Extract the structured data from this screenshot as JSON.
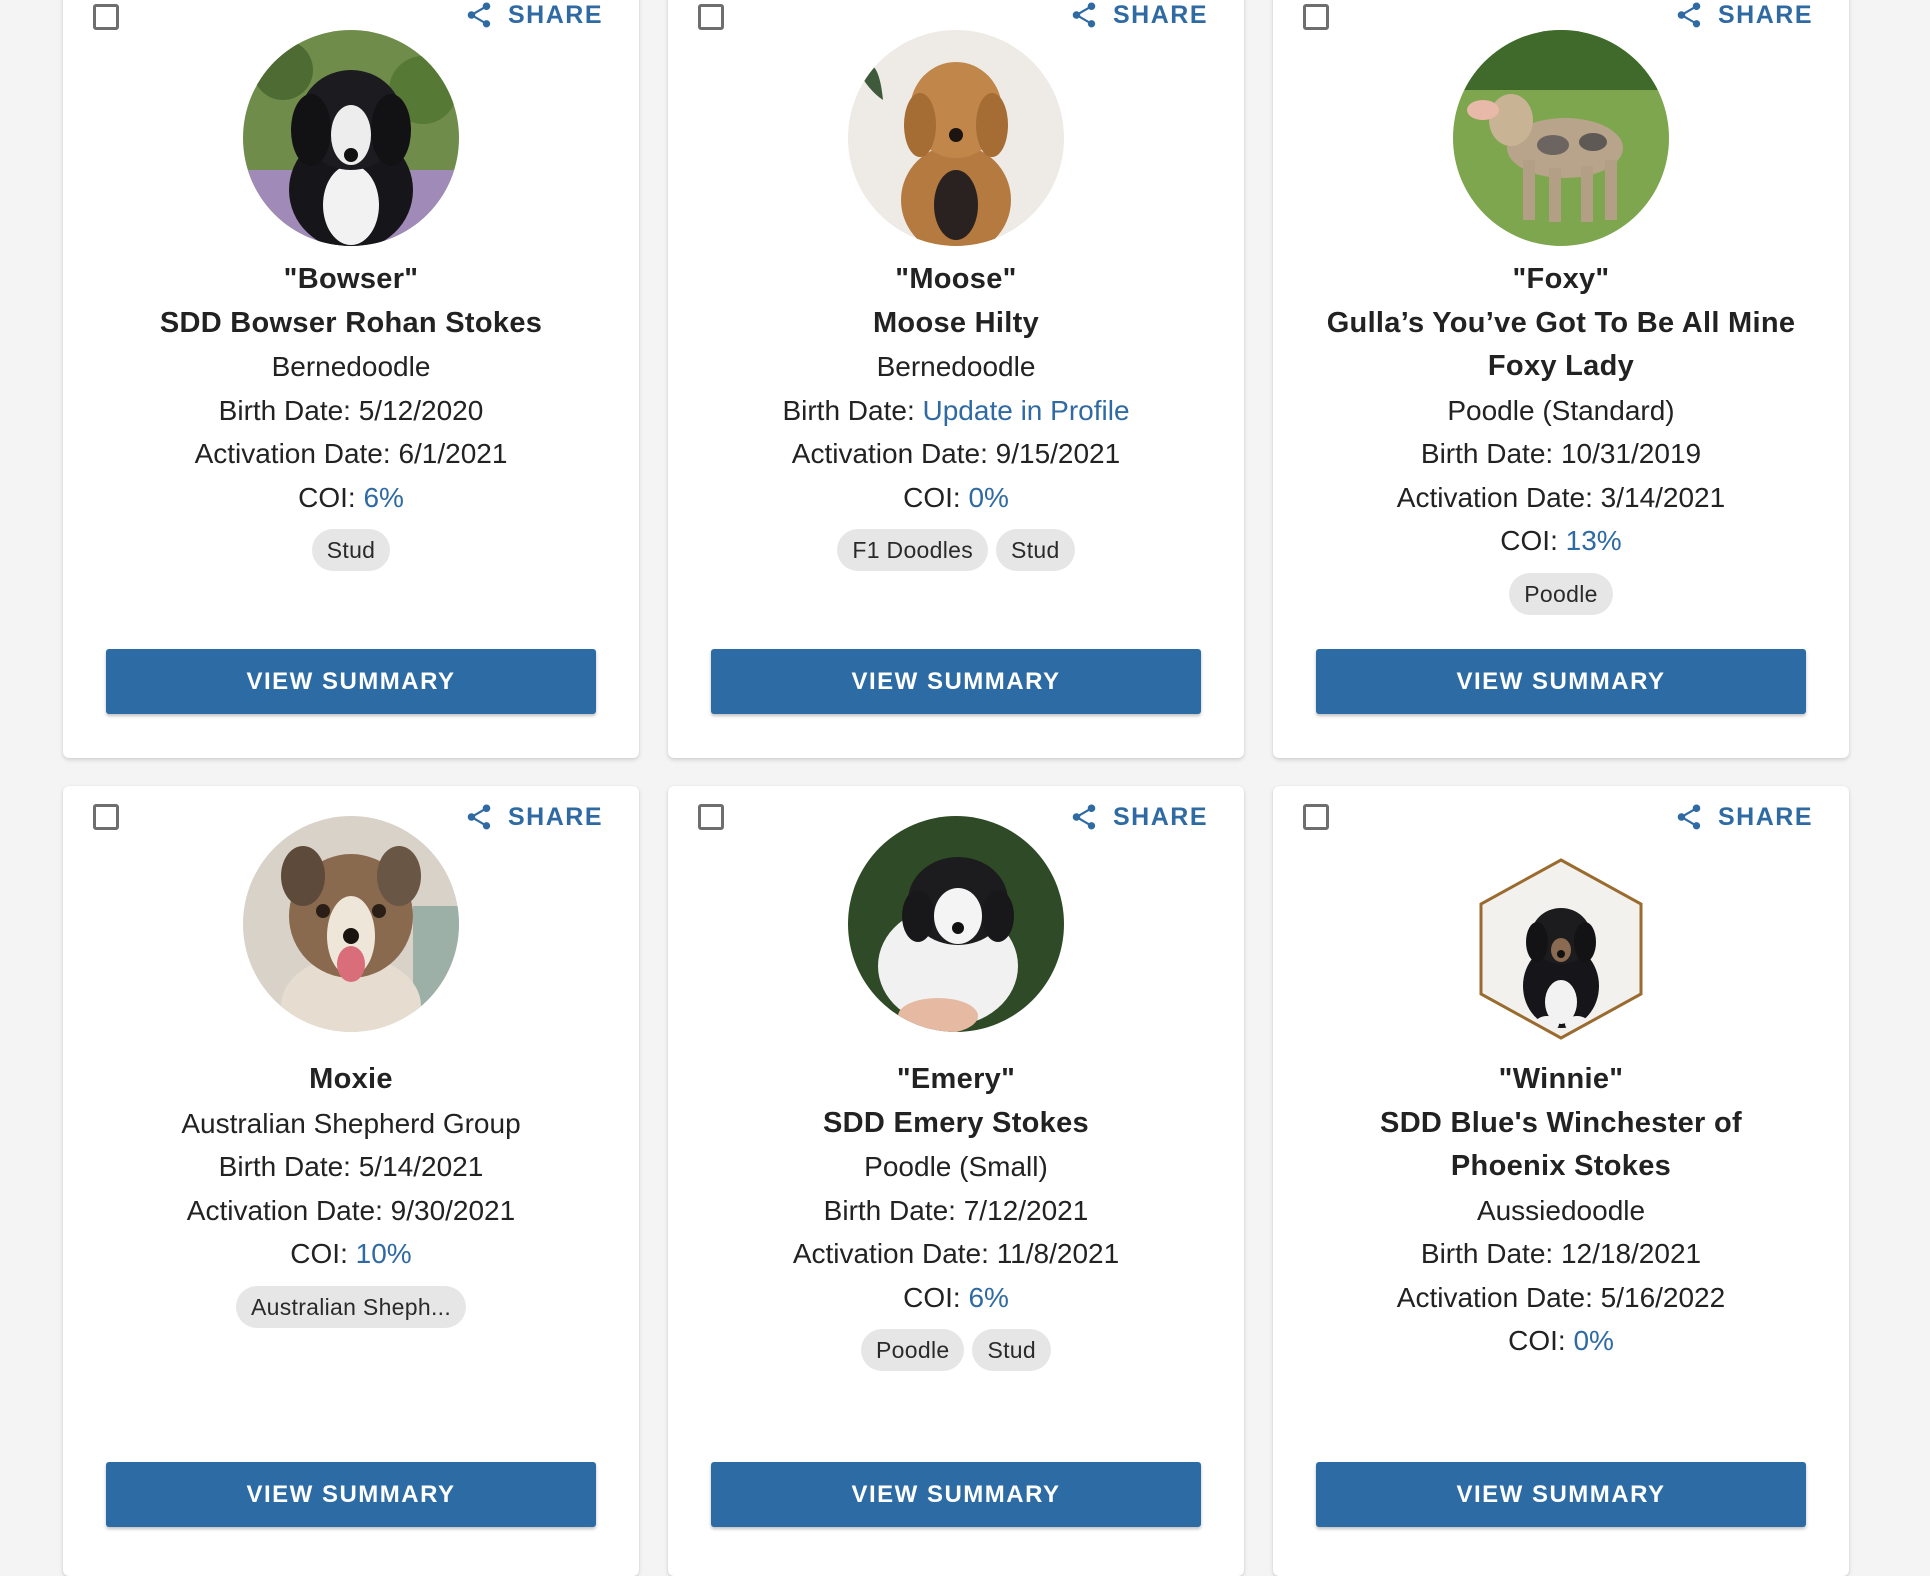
{
  "ui": {
    "share_label": "SHARE",
    "view_summary_label": "VIEW SUMMARY",
    "birth_label": "Birth Date: ",
    "activation_label": "Activation Date: ",
    "coi_label": "COI: ",
    "accent_color": "#2f6aa3",
    "button_color": "#2d6ba5"
  },
  "dogs": [
    {
      "nickname": "\"Bowser\"",
      "name": "SDD Bowser Rohan Stokes",
      "breed": "Bernedoodle",
      "birth_date": "5/12/2020",
      "activation_date": "6/1/2021",
      "coi": "6%",
      "tags": [
        "Stud"
      ]
    },
    {
      "nickname": "\"Moose\"",
      "name": "Moose Hilty",
      "breed": "Bernedoodle",
      "birth_date": "Update in Profile",
      "activation_date": "9/15/2021",
      "coi": "0%",
      "tags": [
        "F1 Doodles",
        "Stud"
      ]
    },
    {
      "nickname": "\"Foxy\"",
      "name_line1": "Gulla’s You’ve Got To Be All Mine",
      "name_line2": "Foxy Lady",
      "breed": "Poodle (Standard)",
      "birth_date": "10/31/2019",
      "activation_date": "3/14/2021",
      "coi": "13%",
      "tags": [
        "Poodle"
      ]
    },
    {
      "name": "Moxie",
      "breed": "Australian Shepherd Group",
      "birth_date": "5/14/2021",
      "activation_date": "9/30/2021",
      "coi": "10%",
      "tags": [
        "Australian Sheph..."
      ]
    },
    {
      "nickname": "\"Emery\"",
      "name": "SDD Emery Stokes",
      "breed": "Poodle (Small)",
      "birth_date": "7/12/2021",
      "activation_date": "11/8/2021",
      "coi": "6%",
      "tags": [
        "Poodle",
        "Stud"
      ]
    },
    {
      "nickname": "\"Winnie\"",
      "name_line1": "SDD Blue's Winchester of",
      "name_line2": "Phoenix Stokes",
      "breed": "Aussiedoodle",
      "birth_date": "12/18/2021",
      "activation_date": "5/16/2022",
      "coi": "0%",
      "tags": []
    }
  ]
}
